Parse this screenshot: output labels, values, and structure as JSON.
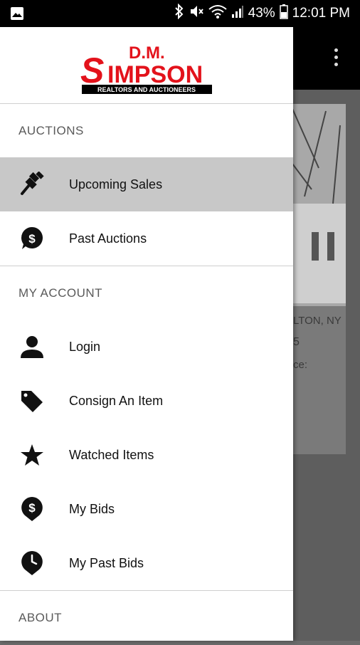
{
  "status_bar": {
    "battery": "43%",
    "time": "12:01 PM",
    "icons": [
      "gallery-icon",
      "bluetooth-icon",
      "mute-icon",
      "wifi-icon",
      "signal-icon",
      "battery-icon"
    ]
  },
  "background": {
    "location_text": "LTON, NY",
    "digit_text": "5",
    "partial_text": "ce:"
  },
  "drawer": {
    "logo": {
      "line1": "D.M.",
      "line2": "SIMPSON",
      "tagline": "REALTORS AND AUCTIONEERS",
      "color": "#e3121b"
    },
    "sections": {
      "auctions": "AUCTIONS",
      "account": "MY ACCOUNT",
      "about": "ABOUT"
    },
    "auction_items": [
      {
        "label": "Upcoming Sales",
        "icon": "gavel-icon",
        "selected": true
      },
      {
        "label": "Past Auctions",
        "icon": "dollar-bubble-icon",
        "selected": false
      }
    ],
    "account_items": [
      {
        "label": "Login",
        "icon": "person-icon"
      },
      {
        "label": "Consign An Item",
        "icon": "tag-icon"
      },
      {
        "label": "Watched Items",
        "icon": "star-icon"
      },
      {
        "label": "My Bids",
        "icon": "dollar-pin-icon"
      },
      {
        "label": "My Past Bids",
        "icon": "clock-pin-icon"
      }
    ]
  }
}
